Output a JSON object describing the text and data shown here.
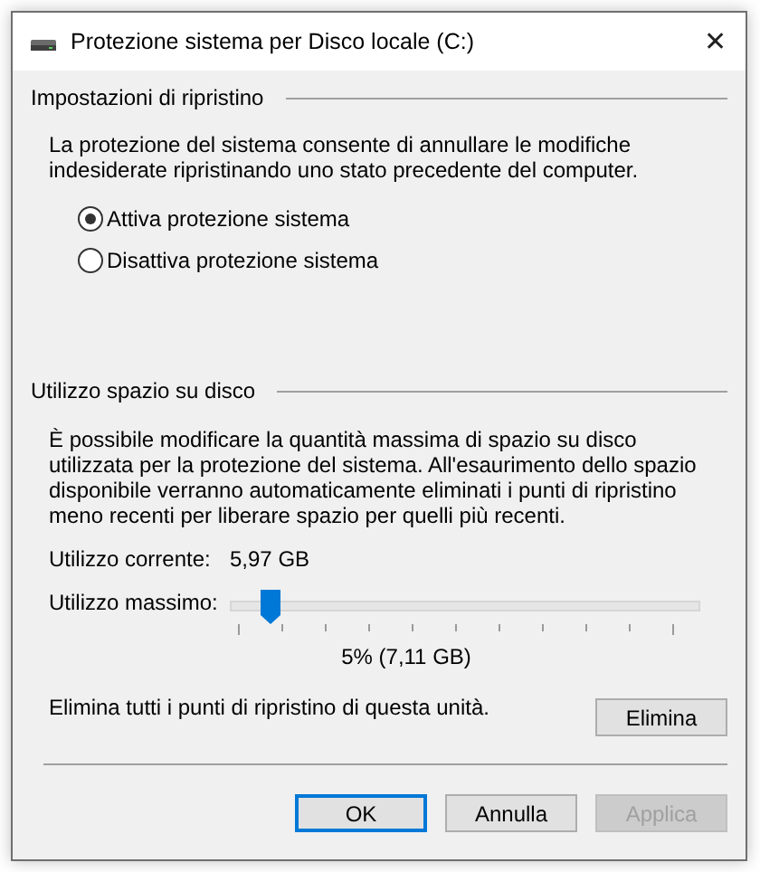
{
  "window": {
    "title": "Protezione sistema per Disco locale (C:)",
    "close": "✕"
  },
  "restore_settings": {
    "heading": "Impostazioni di ripristino",
    "description": "La protezione del sistema consente di annullare le modifiche indesiderate ripristinando uno stato precedente del computer.",
    "options": [
      {
        "label": "Attiva protezione sistema",
        "selected": true
      },
      {
        "label": "Disattiva protezione sistema",
        "selected": false
      }
    ]
  },
  "disk_usage": {
    "heading": "Utilizzo spazio su disco",
    "description": "È possibile modificare la quantità massima di spazio su disco utilizzata per la protezione del sistema. All'esaurimento dello spazio disponibile verranno automaticamente eliminati i punti di ripristino meno recenti per liberare spazio per quelli più recenti.",
    "current_label": "Utilizzo corrente:",
    "current_value": "5,97 GB",
    "max_label": "Utilizzo massimo:",
    "max_slider": {
      "level": 0.05
    },
    "max_reading": "5% (7,11 GB)",
    "delete_text": "Elimina tutti i punti di ripristino di questa unità.",
    "delete_button": "Elimina"
  },
  "buttons": [
    {
      "label": "OK",
      "focused": true,
      "disabled": false
    },
    {
      "label": "Annulla",
      "focused": false,
      "disabled": false
    },
    {
      "label": "Applica",
      "focused": false,
      "disabled": true
    }
  ]
}
